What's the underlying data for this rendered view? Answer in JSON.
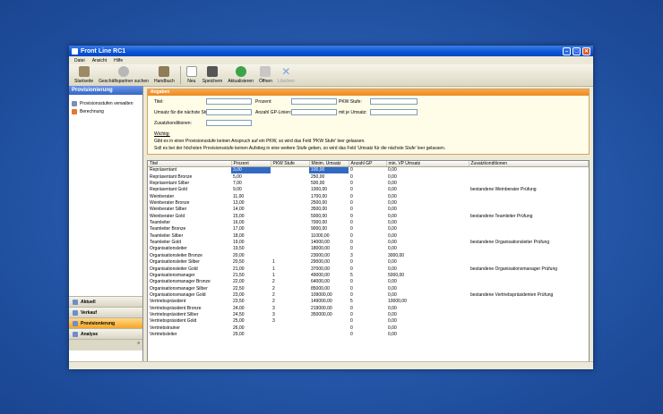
{
  "window": {
    "title": "Front Line RC1"
  },
  "menu": [
    "Datei",
    "Ansicht",
    "Hilfe"
  ],
  "toolbar": [
    {
      "label": "Startseite",
      "icon": "home-icon",
      "disabled": false
    },
    {
      "label": "Geschäftspartner suchen",
      "icon": "search-icon",
      "disabled": false
    },
    {
      "label": "Handbuch",
      "icon": "book-icon",
      "disabled": false
    },
    {
      "label": "Neu",
      "icon": "new-document-icon",
      "disabled": false
    },
    {
      "label": "Speichern",
      "icon": "save-icon",
      "disabled": false
    },
    {
      "label": "Aktualisieren",
      "icon": "refresh-icon",
      "disabled": false
    },
    {
      "label": "Öffnen",
      "icon": "open-icon",
      "disabled": false
    },
    {
      "label": "Löschen",
      "icon": "delete-icon",
      "disabled": true
    }
  ],
  "sidebar": {
    "title": "Provisionierung",
    "items": [
      {
        "label": "Provisionsstufen verwalten",
        "icon": "settings-icon"
      },
      {
        "label": "Berechnung",
        "icon": "calculator-icon"
      }
    ],
    "nav": [
      {
        "label": "Aktuell",
        "active": false
      },
      {
        "label": "Verkauf",
        "active": false
      },
      {
        "label": "Provisionierung",
        "active": true
      },
      {
        "label": "Analyse",
        "active": false
      }
    ],
    "nav_footer": "»"
  },
  "form": {
    "header": "Angaben",
    "titel": "Titel:",
    "prozent": "Prozent:",
    "pkw_stufe": "PKW Stufe:",
    "umsatz": "Umsatz für die nächste Stufe:",
    "anzahl_gp": "Anzahl GP-Linien:",
    "mit_je_umsatz": "mit je Umsatz:",
    "zusatz": "Zusatzkonditionen:",
    "wichtig": "Wichtig:",
    "note1": "Gibt es in einer Provisionsstufe keinen Anspruch auf ein PKW, so wird das Feld 'PKW Stufe' leer gelassen.",
    "note2": "Soll es bei der höchsten Provisionsstufe keinen Aufstieg in eine weitere Stufe geben, so wird das Feld 'Umsatz für die nächste Stufe' leer gelassen."
  },
  "table": {
    "columns": [
      "Titel",
      "Prozent",
      "PKW Stufe",
      "Minim. Umsatz",
      "Anzahl GP",
      "min. VP Umsatz",
      "Zusatzkonditionen"
    ],
    "rows": [
      [
        "Repräsentant",
        "3,00",
        "",
        "100,00",
        "0",
        "0,00",
        ""
      ],
      [
        "Repräsentant Bronze",
        "5,00",
        "",
        "250,00",
        "0",
        "0,00",
        ""
      ],
      [
        "Repräsentant Silber",
        "7,00",
        "",
        "500,00",
        "0",
        "0,00",
        ""
      ],
      [
        "Repräsentant Gold",
        "9,00",
        "",
        "1000,00",
        "0",
        "0,00",
        "bestandene Weinberater Prüfung"
      ],
      [
        "Weinberater",
        "11,00",
        "",
        "1700,00",
        "0",
        "0,00",
        ""
      ],
      [
        "Weinberater Bronze",
        "13,00",
        "",
        "2500,00",
        "0",
        "0,00",
        ""
      ],
      [
        "Weinberater Silber",
        "14,00",
        "",
        "3500,00",
        "0",
        "0,00",
        ""
      ],
      [
        "Weinberater Gold",
        "15,00",
        "",
        "5000,00",
        "0",
        "0,00",
        "bestandene Teamleiter Prüfung"
      ],
      [
        "Teamleiter",
        "16,00",
        "",
        "7000,00",
        "0",
        "0,00",
        ""
      ],
      [
        "Teamleiter Bronze",
        "17,00",
        "",
        "9000,00",
        "0",
        "0,00",
        ""
      ],
      [
        "Teamleiter Silber",
        "18,00",
        "",
        "11000,00",
        "0",
        "0,00",
        ""
      ],
      [
        "Teamleiter Gold",
        "19,00",
        "",
        "14000,00",
        "0",
        "0,00",
        "bestandene Organisationsleiter Prüfung"
      ],
      [
        "Organisationsleiter",
        "19,50",
        "",
        "18000,00",
        "0",
        "0,00",
        ""
      ],
      [
        "Organisationsleiter Bronze",
        "20,00",
        "",
        "23000,00",
        "3",
        "3000,00",
        ""
      ],
      [
        "Organisationsleiter Silber",
        "20,50",
        "1",
        "29000,00",
        "0",
        "0,00",
        ""
      ],
      [
        "Organisationsleiter Gold",
        "21,00",
        "1",
        "37000,00",
        "0",
        "0,00",
        "bestandene Organisationsmanager Prüfung"
      ],
      [
        "Organisationsmanager",
        "21,50",
        "1",
        "49000,00",
        "5",
        "5000,00",
        ""
      ],
      [
        "Organisationsmanager Bronze",
        "22,00",
        "2",
        "64000,00",
        "0",
        "0,00",
        ""
      ],
      [
        "Organisationsmanager Silber",
        "22,50",
        "2",
        "85000,00",
        "0",
        "0,00",
        ""
      ],
      [
        "Organisationsmanager Gold",
        "23,00",
        "2",
        "109000,00",
        "0",
        "0,00",
        "bestandene Vertriebspräsidenten Prüfung"
      ],
      [
        "Vertriebspräsident",
        "23,50",
        "2",
        "149000,00",
        "5",
        "10000,00",
        ""
      ],
      [
        "Vertriebspräsident Bronze",
        "24,00",
        "3",
        "219000,00",
        "0",
        "0,00",
        ""
      ],
      [
        "Vertriebspräsident Silber",
        "24,50",
        "3",
        "350000,00",
        "0",
        "0,00",
        ""
      ],
      [
        "Vertriebspräsident Gold",
        "25,00",
        "3",
        "",
        "0",
        "0,00",
        ""
      ],
      [
        "Vertriebstrainer",
        "26,00",
        "",
        "",
        "0",
        "0,00",
        ""
      ],
      [
        "Vertriebsleiter",
        "29,00",
        "",
        "",
        "0",
        "0,00",
        ""
      ]
    ]
  },
  "colors": {
    "accent_orange": "#ec8a20",
    "selection": "#316ac5",
    "title_blue": "#0a54d8"
  }
}
